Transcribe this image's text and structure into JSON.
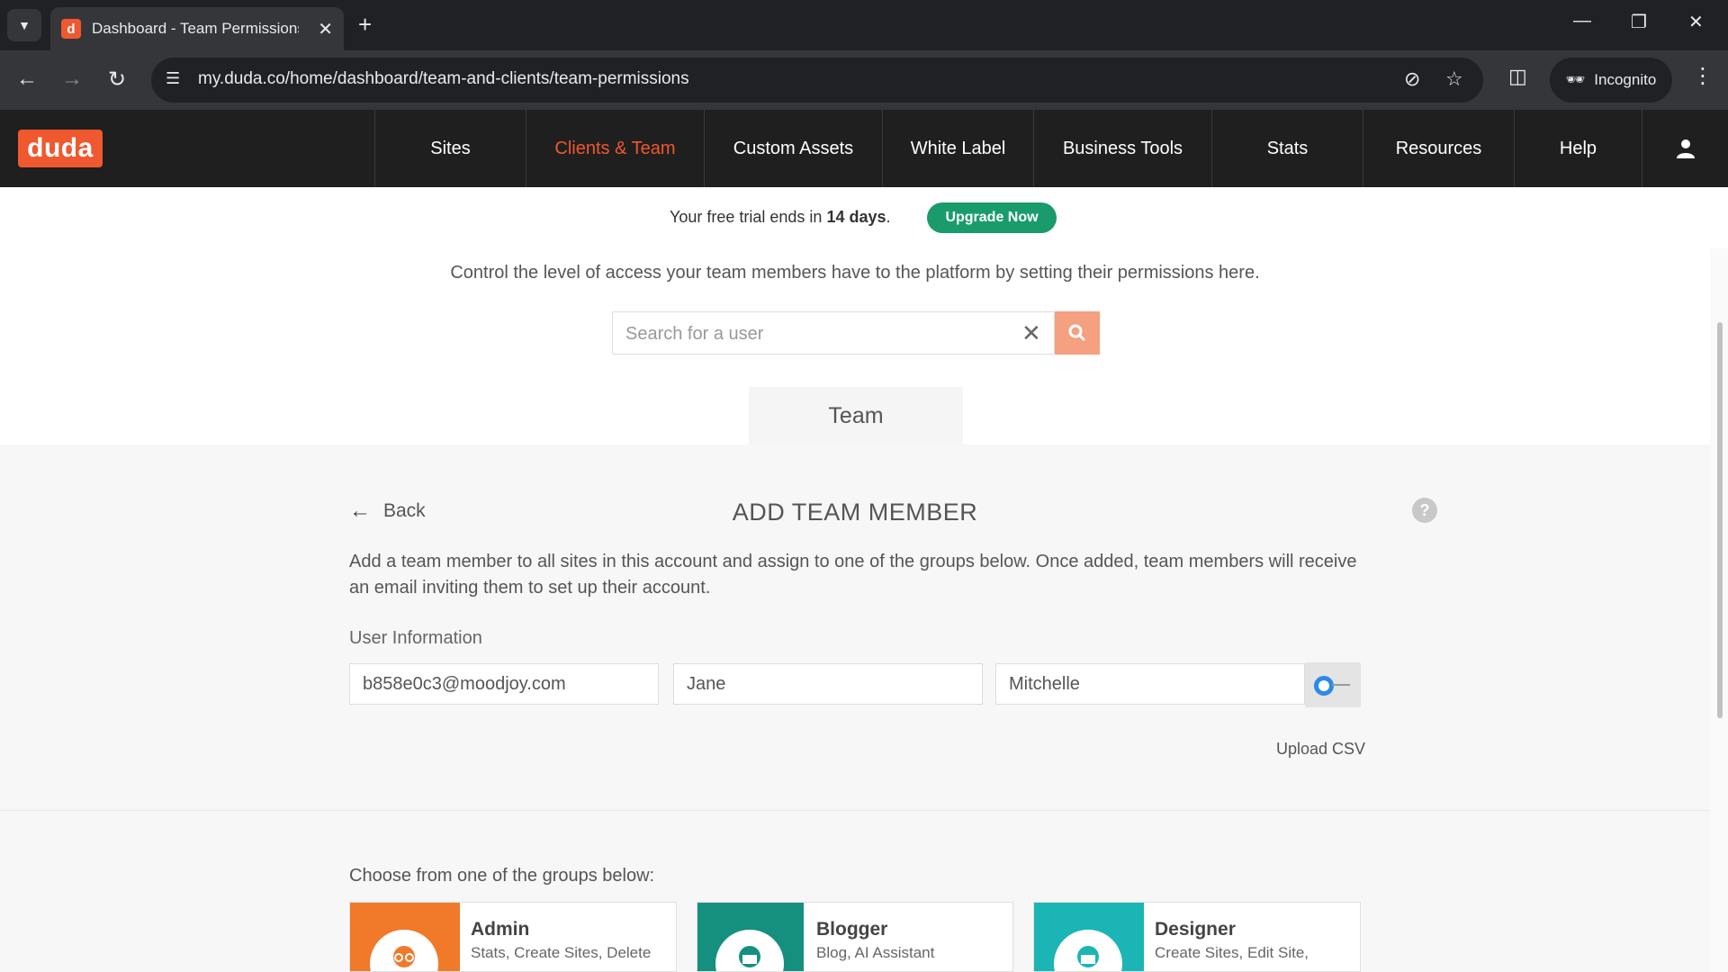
{
  "browser": {
    "tab_title": "Dashboard - Team Permissions",
    "favicon_letter": "d",
    "url": "my.duda.co/home/dashboard/team-and-clients/team-permissions",
    "incognito_label": "Incognito"
  },
  "nav": {
    "logo": "duda",
    "items": [
      {
        "label": "Sites"
      },
      {
        "label": "Clients & Team"
      },
      {
        "label": "Custom Assets"
      },
      {
        "label": "White Label"
      },
      {
        "label": "Business Tools"
      },
      {
        "label": "Stats"
      },
      {
        "label": "Resources"
      },
      {
        "label": "Help"
      }
    ],
    "active_index": 1,
    "active_color": "#f0582f"
  },
  "trial": {
    "text_prefix": "Your free trial ends in ",
    "days": "14 days",
    "text_suffix": ".",
    "upgrade_label": "Upgrade Now",
    "upgrade_color": "#1a9b6b"
  },
  "permissions": {
    "intro": "Control the level of access your team members have to the platform by setting their permissions here.",
    "search_placeholder": "Search for a user",
    "search_value": "",
    "team_tab": "Team"
  },
  "add_member": {
    "back_label": "Back",
    "title": "ADD TEAM MEMBER",
    "help": "?",
    "description": "Add a team member to all sites in this account and assign to one of the groups below. Once added, team members will receive an email inviting them to set up their account.",
    "user_info_label": "User Information",
    "email_value": "b858e0c3@moodjoy.com",
    "first_name_value": "Jane",
    "last_name_value": "Mitchelle",
    "upload_csv": "Upload CSV",
    "choose_label": "Choose from one of the groups below:",
    "groups": [
      {
        "name": "Admin",
        "desc": "Stats, Create Sites, Delete",
        "color": "#f07a2a"
      },
      {
        "name": "Blogger",
        "desc": "Blog, AI Assistant",
        "color": "#15907f"
      },
      {
        "name": "Designer",
        "desc": "Create Sites, Edit Site,",
        "color": "#1bb5b5"
      }
    ]
  }
}
